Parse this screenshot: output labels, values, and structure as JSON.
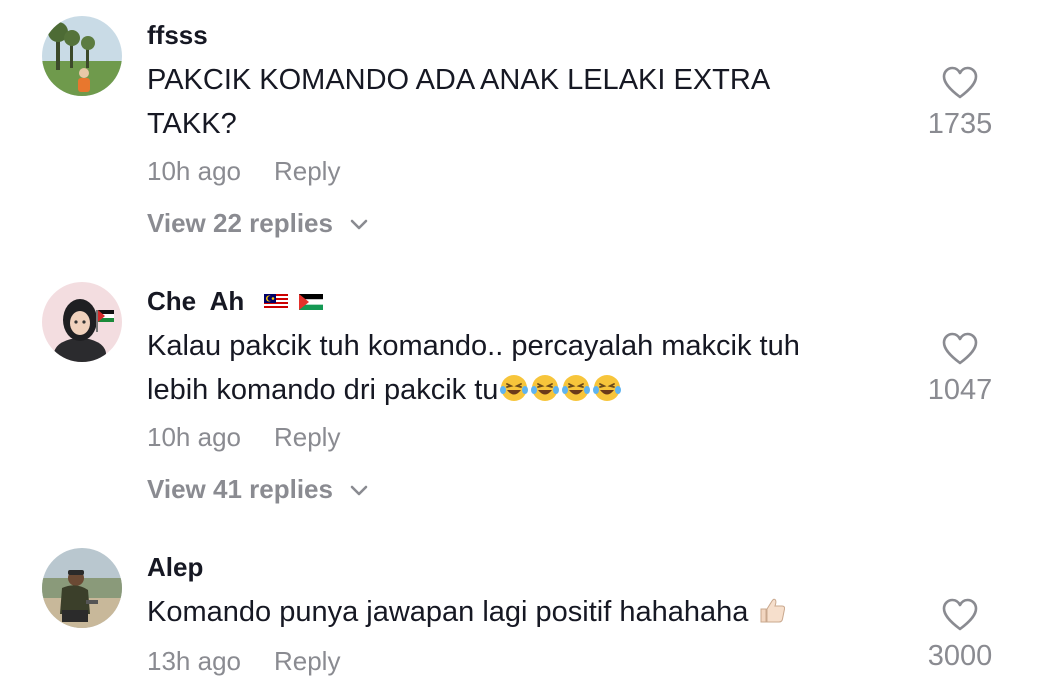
{
  "comments": [
    {
      "username": "ffsss",
      "text_line1": "PAKCIK KOMANDO ADA ANAK LELAKI EXTRA",
      "text_line2": "TAKK?",
      "time": "10h ago",
      "reply_label": "Reply",
      "view_replies": "View 22 replies",
      "likes": "1735"
    },
    {
      "username": "Che  Ah",
      "text_line1": "Kalau pakcik tuh komando.. percayalah makcik tuh",
      "text_line2": "lebih komando dri pakcik tu",
      "time": "10h ago",
      "reply_label": "Reply",
      "view_replies": "View 41 replies",
      "likes": "1047",
      "flag_icons": [
        "malaysia-flag-icon",
        "palestine-flag-icon"
      ],
      "emoji_icons": [
        "laughing-tears-emoji",
        "laughing-tears-emoji",
        "laughing-tears-emoji",
        "laughing-tears-emoji"
      ]
    },
    {
      "username": "Alep",
      "text_line1": "Komando punya jawapan lagi positif hahahaha",
      "time": "13h ago",
      "reply_label": "Reply",
      "likes": "3000",
      "emoji_icons": [
        "thumbs-up-emoji"
      ]
    }
  ],
  "colors": {
    "primary_text": "#161823",
    "secondary_text": "#8a8b91",
    "background": "#ffffff"
  }
}
